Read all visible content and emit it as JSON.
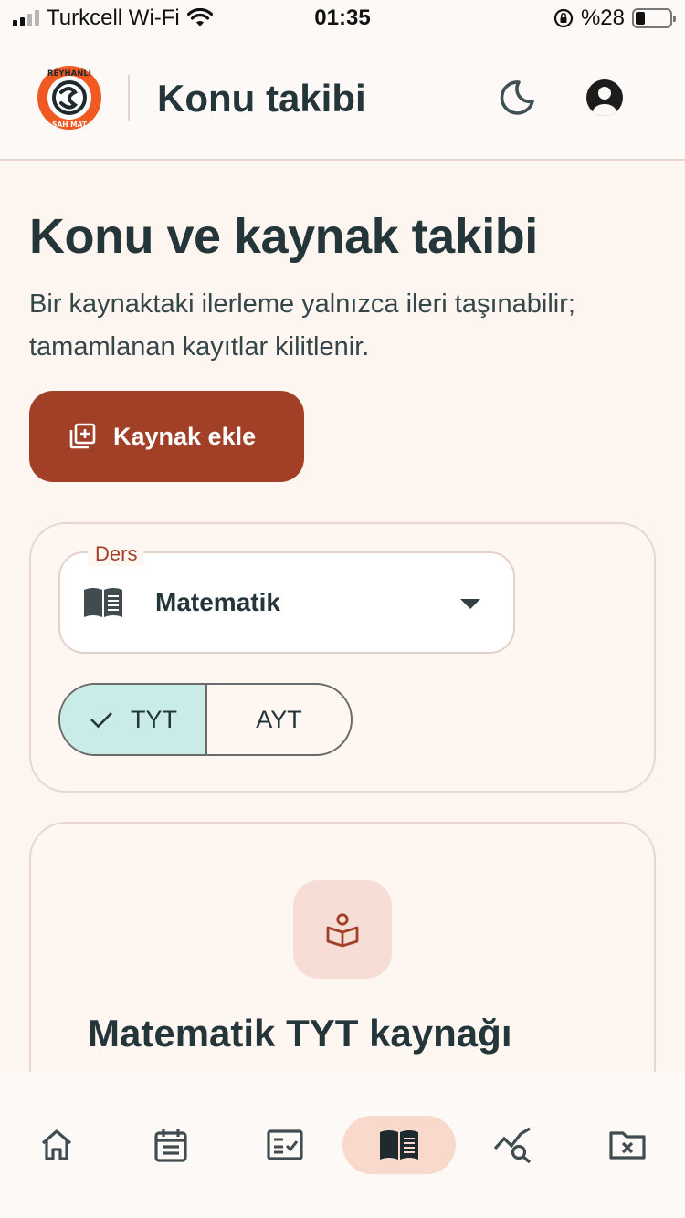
{
  "status_bar": {
    "carrier": "Turkcell Wi-Fi",
    "time": "01:35",
    "battery_text": "%28"
  },
  "app_bar": {
    "title": "Konu takibi",
    "logo_text_top": "REYHANLI",
    "logo_text_bottom": "ŞAH MAT"
  },
  "main": {
    "heading": "Konu ve kaynak takibi",
    "description": "Bir kaynaktaki ilerleme yalnızca ileri taşınabilir; tamamlanan kayıtlar kilitlenir.",
    "add_button_label": "Kaynak ekle"
  },
  "filter": {
    "subject_label": "Ders",
    "subject_value": "Matematik",
    "exam_types": [
      {
        "label": "TYT",
        "selected": true
      },
      {
        "label": "AYT",
        "selected": false
      }
    ]
  },
  "source_card": {
    "title": "Matematik TYT kaynağı"
  },
  "bottom_nav": {
    "items": [
      "home-icon",
      "calendar-icon",
      "checklist-icon",
      "book-icon",
      "analytics-icon",
      "folder-x-icon"
    ],
    "active_index": 3
  },
  "colors": {
    "primary": "#a13f27",
    "background": "#fdf5ef",
    "text": "#24363a",
    "selected_segment": "#c9ece8",
    "nav_active": "#f8d9cb"
  }
}
